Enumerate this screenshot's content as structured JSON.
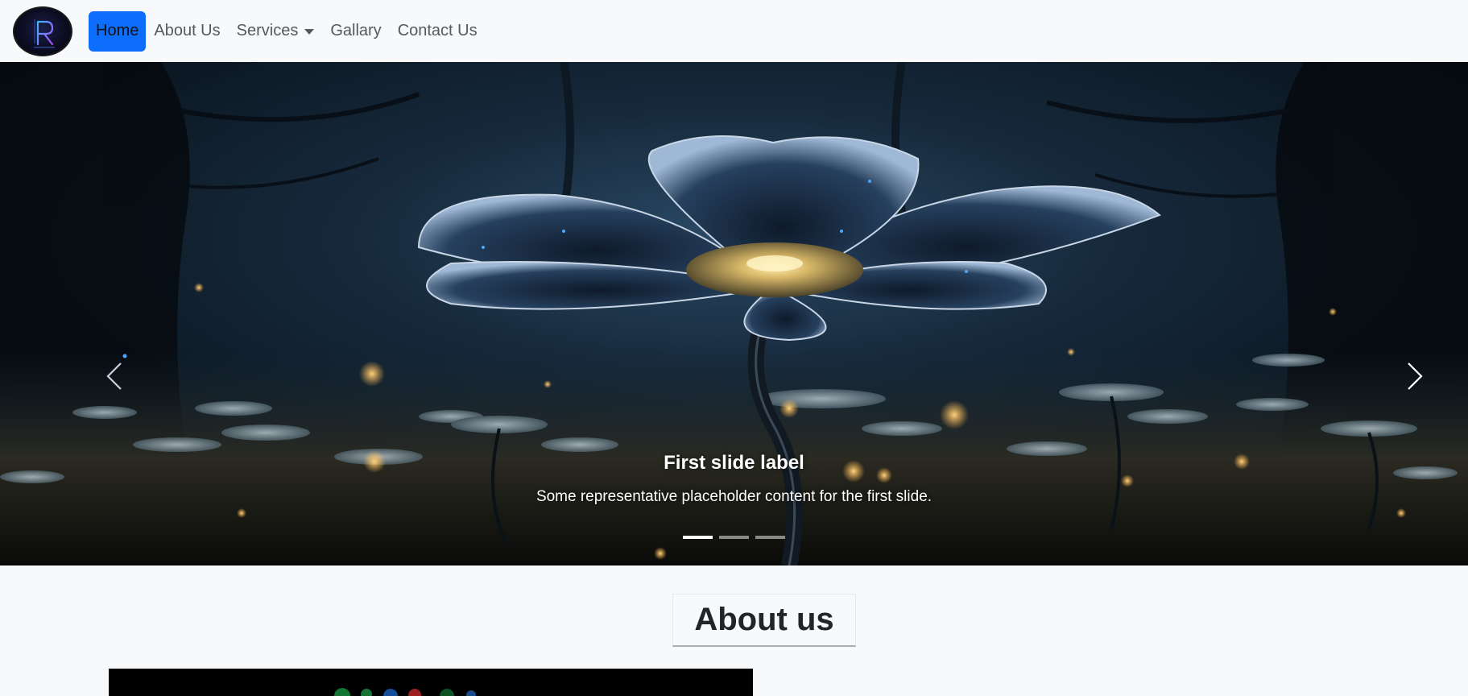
{
  "navbar": {
    "logo_name": "R logo",
    "items": [
      {
        "label": "Home",
        "active": true
      },
      {
        "label": "About Us"
      },
      {
        "label": "Services",
        "dropdown": true
      },
      {
        "label": "Gallary"
      },
      {
        "label": "Contact Us"
      }
    ],
    "accent_color": "#0d6efd"
  },
  "carousel": {
    "caption_title": "First slide label",
    "caption_text": "Some representative placeholder content for the first slide.",
    "slides_count": 3,
    "active_slide": 1,
    "prev_icon": "chevron-left-icon",
    "next_icon": "chevron-right-icon"
  },
  "about": {
    "heading": "About us"
  }
}
